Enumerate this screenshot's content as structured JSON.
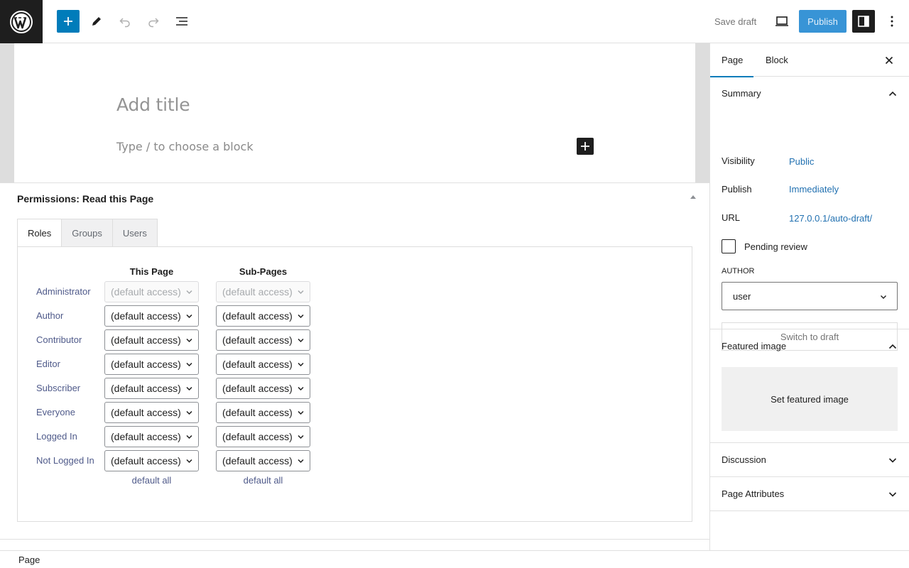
{
  "toolbar": {
    "save_draft": "Save draft",
    "publish": "Publish",
    "icons": [
      "wordpress-logo",
      "plus",
      "pencil",
      "undo",
      "redo",
      "list-view",
      "desktop-preview",
      "sidebar-settings",
      "more-vertical"
    ]
  },
  "editor": {
    "title_placeholder": "Add title",
    "block_placeholder": "Type / to choose a block"
  },
  "permissions": {
    "title": "Permissions: Read this Page",
    "tabs": [
      "Roles",
      "Groups",
      "Users"
    ],
    "col_this": "This Page",
    "col_sub": "Sub-Pages",
    "roles": [
      {
        "name": "Administrator",
        "this": "(default access)",
        "sub": "(default access)",
        "disabled": true
      },
      {
        "name": "Author",
        "this": "(default access)",
        "sub": "(default access)",
        "disabled": false
      },
      {
        "name": "Contributor",
        "this": "(default access)",
        "sub": "(default access)",
        "disabled": false
      },
      {
        "name": "Editor",
        "this": "(default access)",
        "sub": "(default access)",
        "disabled": false
      },
      {
        "name": "Subscriber",
        "this": "(default access)",
        "sub": "(default access)",
        "disabled": false
      },
      {
        "name": "Everyone",
        "this": "(default access)",
        "sub": "(default access)",
        "disabled": false
      },
      {
        "name": "Logged In",
        "this": "(default access)",
        "sub": "(default access)",
        "disabled": false
      },
      {
        "name": "Not Logged In",
        "this": "(default access)",
        "sub": "(default access)",
        "disabled": false
      }
    ],
    "default_all": "default all"
  },
  "footer": {
    "breadcrumb": "Page"
  },
  "sidebar": {
    "tab_page": "Page",
    "tab_block": "Block",
    "summary": {
      "title": "Summary",
      "visibility_label": "Visibility",
      "visibility_value": "Public",
      "publish_label": "Publish",
      "publish_value": "Immediately",
      "url_label": "URL",
      "url_value": "127.0.0.1/auto-draft/",
      "pending_review": "Pending review",
      "author_label": "AUTHOR",
      "author_value": "user",
      "switch_to_draft": "Switch to draft"
    },
    "featured_image": {
      "title": "Featured image",
      "button": "Set featured image"
    },
    "discussion": "Discussion",
    "page_attributes": "Page Attributes"
  },
  "colors": {
    "accent": "#007cba",
    "publish_bg": "#3894d6",
    "link": "#2271b1",
    "dark": "#1e1e1e"
  }
}
